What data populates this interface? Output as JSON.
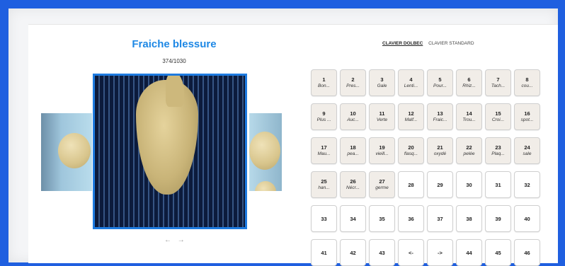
{
  "app": {
    "title": "Fraiche blessure",
    "counter": "374/1030"
  },
  "keyboard_tabs": [
    {
      "label": "CLAVIER DOLBEC",
      "active": true
    },
    {
      "label": "CLAVIER STANDARD",
      "active": false
    }
  ],
  "carousel": {
    "prev_icon": "arrow-left-icon",
    "next_icon": "arrow-right-icon",
    "prev_glyph": "←",
    "next_glyph": "→"
  },
  "keys": [
    {
      "num": "1",
      "label": "Bon..."
    },
    {
      "num": "2",
      "label": "Pres..."
    },
    {
      "num": "3",
      "label": "Gale"
    },
    {
      "num": "4",
      "label": "Lenti..."
    },
    {
      "num": "5",
      "label": "Pour..."
    },
    {
      "num": "6",
      "label": "Rhiz..."
    },
    {
      "num": "7",
      "label": "Tach..."
    },
    {
      "num": "8",
      "label": "cou..."
    },
    {
      "num": "9",
      "label": "Plus ..."
    },
    {
      "num": "10",
      "label": "Auc..."
    },
    {
      "num": "11",
      "label": "Verte"
    },
    {
      "num": "12",
      "label": "Malf..."
    },
    {
      "num": "13",
      "label": "Fraic..."
    },
    {
      "num": "14",
      "label": "Trou..."
    },
    {
      "num": "15",
      "label": "Croi..."
    },
    {
      "num": "16",
      "label": "spot..."
    },
    {
      "num": "17",
      "label": "Mau..."
    },
    {
      "num": "18",
      "label": "pea..."
    },
    {
      "num": "19",
      "label": "vieill..."
    },
    {
      "num": "20",
      "label": "flasq..."
    },
    {
      "num": "21",
      "label": "oxydé"
    },
    {
      "num": "22",
      "label": "pelée"
    },
    {
      "num": "23",
      "label": "Plaq..."
    },
    {
      "num": "24",
      "label": "sale"
    },
    {
      "num": "25",
      "label": "han..."
    },
    {
      "num": "26",
      "label": "Nécr..."
    },
    {
      "num": "27",
      "label": "germe"
    },
    {
      "num": "28",
      "label": ""
    },
    {
      "num": "29",
      "label": ""
    },
    {
      "num": "30",
      "label": ""
    },
    {
      "num": "31",
      "label": ""
    },
    {
      "num": "32",
      "label": ""
    },
    {
      "num": "33",
      "label": ""
    },
    {
      "num": "34",
      "label": ""
    },
    {
      "num": "35",
      "label": ""
    },
    {
      "num": "36",
      "label": ""
    },
    {
      "num": "37",
      "label": ""
    },
    {
      "num": "38",
      "label": ""
    },
    {
      "num": "39",
      "label": ""
    },
    {
      "num": "40",
      "label": ""
    },
    {
      "num": "41",
      "label": ""
    },
    {
      "num": "42",
      "label": ""
    },
    {
      "num": "43",
      "label": ""
    },
    {
      "num": "<-",
      "label": ""
    },
    {
      "num": "->",
      "label": ""
    },
    {
      "num": "44",
      "label": ""
    },
    {
      "num": "45",
      "label": ""
    },
    {
      "num": "46",
      "label": ""
    }
  ],
  "colors": {
    "accent": "#1e88e5",
    "outer_bg": "#1f5fe0",
    "key_used_bg": "#f1ede8"
  }
}
